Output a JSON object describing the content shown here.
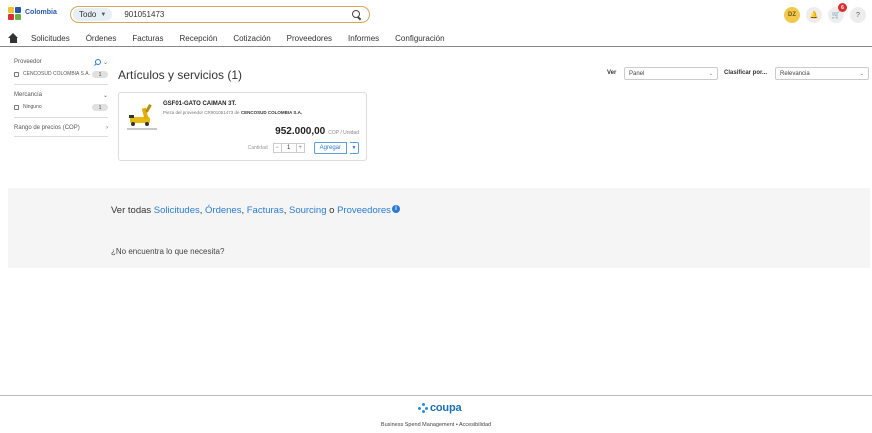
{
  "header": {
    "logo_name": "Colombia",
    "search_scope": "Todo",
    "search_value": "901051473",
    "avatar_initials": "DZ",
    "cart_badge": "6",
    "help_label": "?"
  },
  "nav": {
    "items": [
      "Solicitudes",
      "Órdenes",
      "Facturas",
      "Recepción",
      "Cotización",
      "Proveedores",
      "Informes",
      "Configuración"
    ]
  },
  "sidebar": {
    "supplier_title": "Proveedor",
    "supplier_option": "CENCOSUD COLOMBIA S.A.",
    "supplier_count": "1",
    "merch_title": "Mercancía",
    "merch_option": "Ninguno",
    "merch_count": "1",
    "price_range_title": "Rango de precios (COP)"
  },
  "main": {
    "results_title": "Artículos y servicios (1)",
    "view_label": "Ver",
    "view_value": "Panel",
    "sort_label": "Clasificar por...",
    "sort_value": "Relevancia"
  },
  "product": {
    "name": "GSF01-GATO CAIMAN 3T.",
    "sub_prefix": "Pieza del proveedor CR901051473 de",
    "sub_supplier": "CENCOSUD COLOMBIA S.A.",
    "price": "952.000,00",
    "unit": "COP / Unidad",
    "qty_label": "Cantidad",
    "qty_value": "1",
    "add_label": "Agregar"
  },
  "banner": {
    "see_all_prefix": "Ver todas",
    "links": [
      "Solicitudes",
      "Órdenes",
      "Facturas",
      "Sourcing"
    ],
    "or_word": "o",
    "last_link": "Proveedores",
    "not_found": "¿No encuentra lo que necesita?"
  },
  "footer": {
    "brand": "coupa",
    "links": "Business Spend Management  •  Accesibilidad"
  },
  "colors": {
    "accent": "#2a7bd4",
    "search_border": "#d9a55b",
    "avatar": "#f3c84b",
    "badge": "#d83030"
  }
}
